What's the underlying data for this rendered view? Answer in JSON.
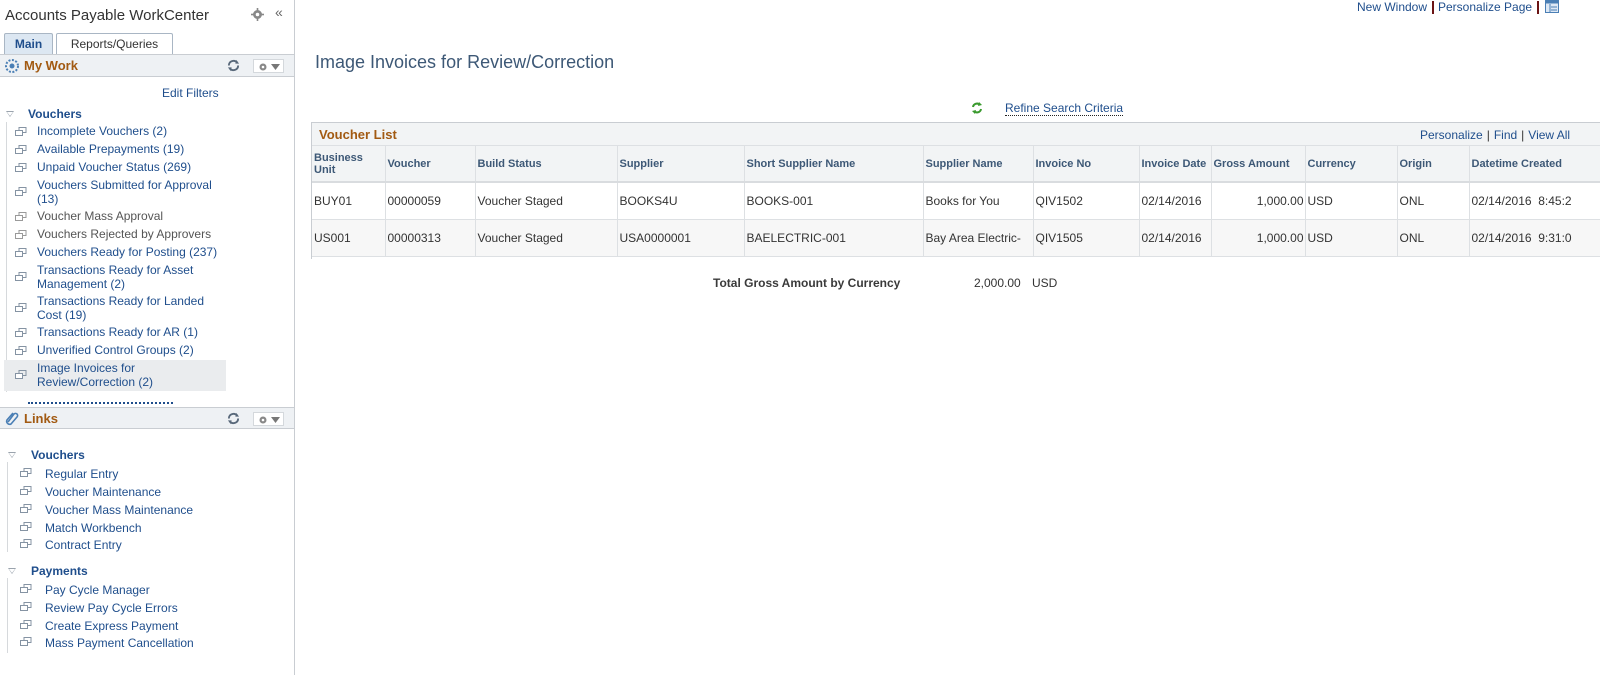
{
  "workcenter": {
    "title": "Accounts Payable WorkCenter",
    "tabs": [
      {
        "label": "Main",
        "active": true
      },
      {
        "label": "Reports/Queries",
        "active": false
      }
    ]
  },
  "my_work": {
    "title": "My Work",
    "edit_filters": "Edit Filters",
    "section": "Vouchers",
    "items": [
      {
        "label": "Incomplete Vouchers (2)",
        "link": true
      },
      {
        "label": "Available Prepayments (19)",
        "link": true
      },
      {
        "label": "Unpaid Voucher Status (269)",
        "link": true
      },
      {
        "label": "Vouchers Submitted for Approval (13)",
        "link": true
      },
      {
        "label": "Voucher Mass Approval",
        "link": false
      },
      {
        "label": "Vouchers Rejected by Approvers",
        "link": false
      },
      {
        "label": "Vouchers Ready for Posting (237)",
        "link": true
      },
      {
        "label": "Transactions Ready for Asset Management (2)",
        "link": true
      },
      {
        "label": "Transactions Ready for Landed Cost (19)",
        "link": true
      },
      {
        "label": "Transactions Ready for AR (1)",
        "link": true
      },
      {
        "label": "Unverified Control Groups (2)",
        "link": true
      },
      {
        "label": "Image Invoices for Review/Correction (2)",
        "link": true,
        "selected": true
      }
    ]
  },
  "links": {
    "title": "Links",
    "sections": [
      {
        "label": "Vouchers",
        "items": [
          "Regular Entry",
          "Voucher Maintenance",
          "Voucher Mass Maintenance",
          "Match Workbench",
          "Contract Entry"
        ]
      },
      {
        "label": "Payments",
        "items": [
          "Pay Cycle Manager",
          "Review Pay Cycle Errors",
          "Create Express Payment",
          "Mass Payment Cancellation"
        ]
      }
    ]
  },
  "toplinks": {
    "new_window": "New Window",
    "personalize_page": "Personalize Page"
  },
  "page": {
    "title": "Image Invoices for Review/Correction",
    "refine": "Refine Search Criteria"
  },
  "grid": {
    "title": "Voucher List",
    "nav": {
      "personalize": "Personalize",
      "find": "Find",
      "view_all": "View All"
    },
    "columns": [
      "Business Unit",
      "Voucher",
      "Build Status",
      "Supplier",
      "Short Supplier Name",
      "Supplier Name",
      "Invoice No",
      "Invoice Date",
      "Gross Amount",
      "Currency",
      "Origin",
      "Datetime Created"
    ],
    "rows": [
      [
        "BUY01",
        "00000059",
        "Voucher Staged",
        "BOOKS4U",
        "BOOKS-001",
        "Books for You",
        "QIV1502",
        "02/14/2016",
        "1,000.00",
        "USD",
        "ONL",
        "02/14/2016  8:45:2"
      ],
      [
        "US001",
        "00000313",
        "Voucher Staged",
        "USA0000001",
        "BAELECTRIC-001",
        "Bay Area Electric-",
        "QIV1505",
        "02/14/2016",
        "1,000.00",
        "USD",
        "ONL",
        "02/14/2016  9:31:0"
      ]
    ],
    "link_columns": [
      1,
      3
    ]
  },
  "total": {
    "label": "Total Gross Amount by Currency",
    "value": "2,000.00",
    "currency": "USD"
  },
  "colors": {
    "link": "#1f4e8c",
    "pagelet_title": "#a25a12",
    "heading": "#3d5876"
  }
}
